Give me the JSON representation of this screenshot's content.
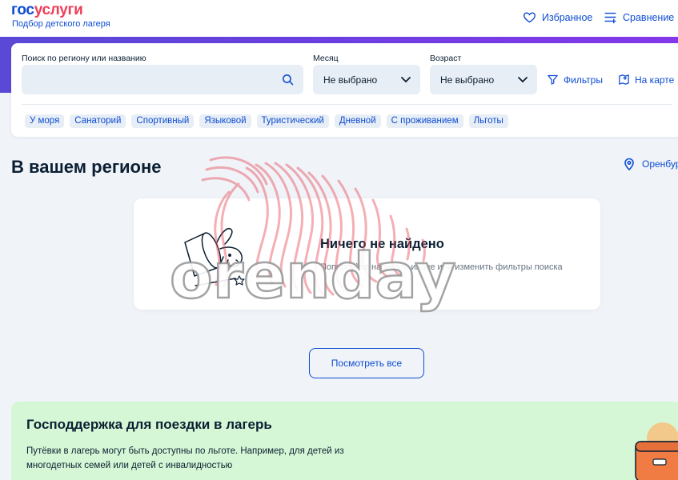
{
  "header": {
    "logo_part1": "гос",
    "logo_part2": "услуги",
    "subtitle": "Подбор детского лагеря",
    "favorites_label": "Избранное",
    "compare_label": "Сравнение"
  },
  "search": {
    "query_label": "Поиск по региону или названию",
    "query_value": "",
    "month_label": "Месяц",
    "month_value": "Не выбрано",
    "age_label": "Возраст",
    "age_value": "Не выбрано",
    "filters_label": "Фильтры",
    "map_label": "На карте",
    "chips": [
      "У моря",
      "Санаторий",
      "Спортивный",
      "Языковой",
      "Туристический",
      "Дневной",
      "С проживанием",
      "Льготы"
    ]
  },
  "region": {
    "title": "В вашем регионе",
    "city": "Оренбург"
  },
  "empty_state": {
    "title": "Ничего не найдено",
    "text": "Попробуйте написать иначе или изменить фильтры поиска"
  },
  "view_all_label": "Посмотреть все",
  "promo": {
    "title": "Господдержка для поездки в лагерь",
    "text": "Путёвки в лагерь могут быть доступны по льготе. Например, для детей из многодетных семей или детей с инвалидностью"
  },
  "watermark_text": "orenday",
  "colors": {
    "brand_blue": "#0d4cd3",
    "brand_red": "#ee3f58",
    "hero_gradient_start": "#5a49d6",
    "hero_gradient_end": "#8438ea",
    "promo_bg": "#d6f7d5",
    "page_bg": "#f0f4f9"
  }
}
